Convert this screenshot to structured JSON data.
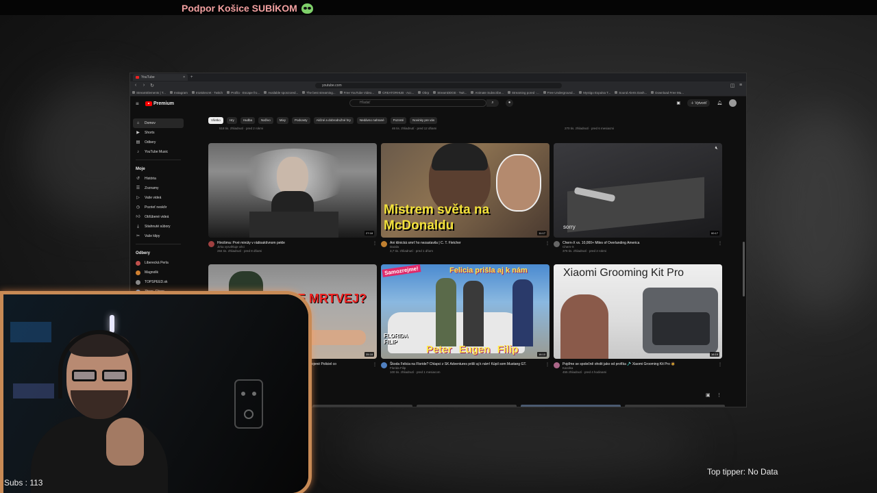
{
  "overlay": {
    "banner_text": "Podpor Košice SUBÍKOM",
    "banner_icon": "alien-icon",
    "subs_text": "Subs : 113",
    "tipper_text": "Top tipper: No Data"
  },
  "browser": {
    "tab_title": "YouTube",
    "url": "youtube.com",
    "bookmarks": [
      "StreamElements | T...",
      "Instagram",
      "Inivisitecret · Twitch",
      "Profilo · Escape fro...",
      "Available sponzored...",
      "The best streaming...",
      "Free YouTube Video...",
      "CREATORHUB · Acc...",
      "Obrp",
      "StreamDDGE · Twit...",
      "Animate Subscribe...",
      "Streaming pored ·...",
      "Free Underground...",
      "Mystigo Expulsa T...",
      "Sound Alerts Dash...",
      "Download Free Mu..."
    ]
  },
  "youtube": {
    "logo_text": "Premium",
    "search_placeholder": "Hľadať",
    "create_label": "Vytvoriť",
    "sidebar": {
      "main": [
        {
          "label": "Domov",
          "icon": "home-icon",
          "active": true
        },
        {
          "label": "Shorts",
          "icon": "shorts-icon"
        },
        {
          "label": "Odbery",
          "icon": "subscriptions-icon"
        },
        {
          "label": "YouTube Music",
          "icon": "music-icon"
        }
      ],
      "you_heading": "Moje",
      "you": [
        {
          "label": "História",
          "icon": "history-icon"
        },
        {
          "label": "Zoznamy",
          "icon": "playlist-icon"
        },
        {
          "label": "Vaše videá",
          "icon": "video-icon"
        },
        {
          "label": "Pozrieť neskôr",
          "icon": "clock-icon"
        },
        {
          "label": "Obľúbené videá",
          "icon": "like-icon"
        },
        {
          "label": "Stiahnuté súbory",
          "icon": "download-icon"
        },
        {
          "label": "Vaše klipy",
          "icon": "scissors-icon"
        }
      ],
      "subs_heading": "Odbery",
      "subs": [
        {
          "label": "Liberecká Perla",
          "color": "#c0504d"
        },
        {
          "label": "Magnolik",
          "color": "#d08030"
        },
        {
          "label": "TOPSPEED.sk",
          "color": "#888888"
        },
        {
          "label": "Zitron_Citron",
          "color": "#6a9ad0"
        }
      ]
    },
    "chips": [
      "Všetko",
      "Hry",
      "Hudba",
      "Naživo",
      "Mixy",
      "Podcasty",
      "Akčné a dobrodružné hry",
      "Nedávno nahrané",
      "Pozreté",
      "Novinky pre vás"
    ],
    "prev_row": [
      "518 tis. zhliadnutí · pred 2 rokmi",
      "46 tis. zhliadnutí · pred 12 dňami",
      "270 tis. zhliadnutí · pred 6 mesiacmi"
    ],
    "videos": [
      {
        "title": "Hirošima: Prvé minúty v rádioaktívnom pekle",
        "channel": "Jirka vysvětluje věci",
        "stats": "284 tis. zhliadnutí · pred 8 dňami",
        "duration": "27:18",
        "thumb_text": "",
        "ch_color": "#a04040"
      },
      {
        "title": "Ani klinická smrť ho nezastavila | C. T. Fletcher",
        "channel": "Dazda",
        "stats": "3,7 tis. zhliadnutí · pred 1 dňom",
        "duration": "11:17",
        "thumb_text": "Mistrem světa na McDonaldu",
        "ch_color": "#c08030"
      },
      {
        "title": "Chern-X vs. 10,000+ Miles of Overlanding America",
        "channel": "Chern-X",
        "stats": "376 tis. zhliadnutí · pred 2 rokmi",
        "duration": "00:17",
        "thumb_text": "sorry",
        "ch_color": "#666666"
      },
      {
        "title": "Ozbrojené Policiel co",
        "channel": "",
        "stats": "",
        "duration": "35:18",
        "thumb_text": "JE MRTVEJ?",
        "ch_color": "#555555"
      },
      {
        "title": "Škoda Felicia na Floride? Chlapci z SK Adventures prišli aj k nám! Kúpil som Mustang GT.",
        "channel": "Florida Filip",
        "stats": "100 tis. zhliadnutí · pred 1 mesiacom",
        "duration": "16:10",
        "thumb_text": "Felicia prišla aj k nám",
        "thumb_text2": "Peter Eugen Filip",
        "thumb_text3": "Samozrejme!",
        "thumb_text4": "FLORIDA FILIP",
        "ch_color": "#5080c0"
      },
      {
        "title": "Pojďme se společně oholit jako od profíka 🪒 Xiaomi Grooming Kit Pro 🧔",
        "channel": "Karolka",
        "stats": "455 zhliadnutí · pred 4 hodinami",
        "duration": "16:19",
        "thumb_text": "Xiaomi Grooming Kit Pro",
        "ch_color": "#aa6688"
      }
    ]
  }
}
